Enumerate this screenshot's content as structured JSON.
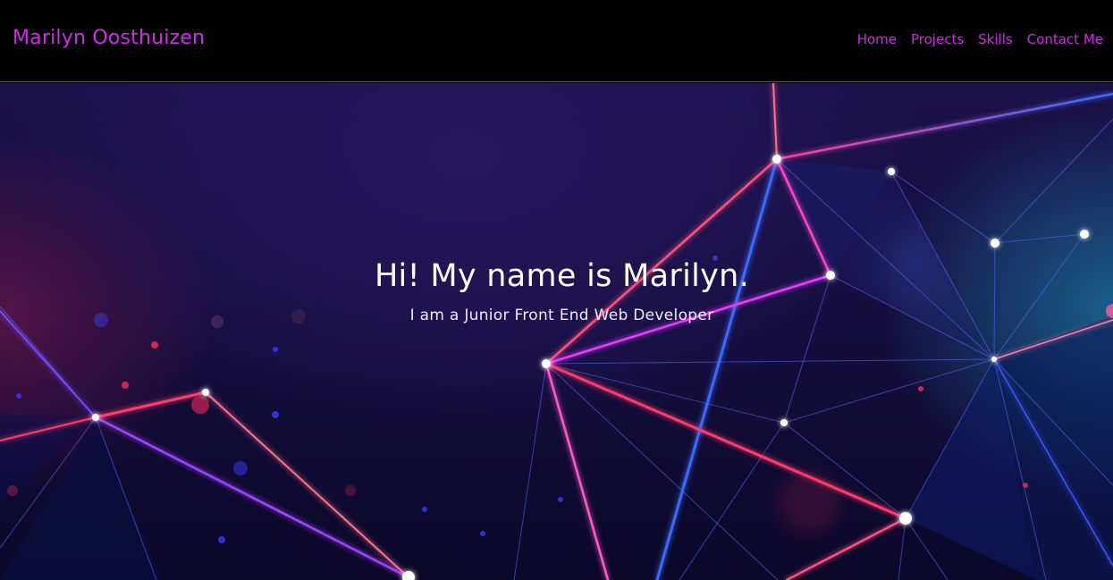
{
  "header": {
    "brand": "Marilyn Oosthuizen",
    "nav": [
      {
        "label": "Home"
      },
      {
        "label": "Projects"
      },
      {
        "label": "Skills"
      },
      {
        "label": "Contact Me"
      }
    ]
  },
  "hero": {
    "title": "Hi! My name is Marilyn.",
    "subtitle": "I am a Junior Front End Web Developer",
    "background": "neon-polygon-network"
  },
  "colors": {
    "accent": "#d02be6",
    "nav_bg": "#000000",
    "hero_bg": "#160f40",
    "text": "#ffffff"
  }
}
